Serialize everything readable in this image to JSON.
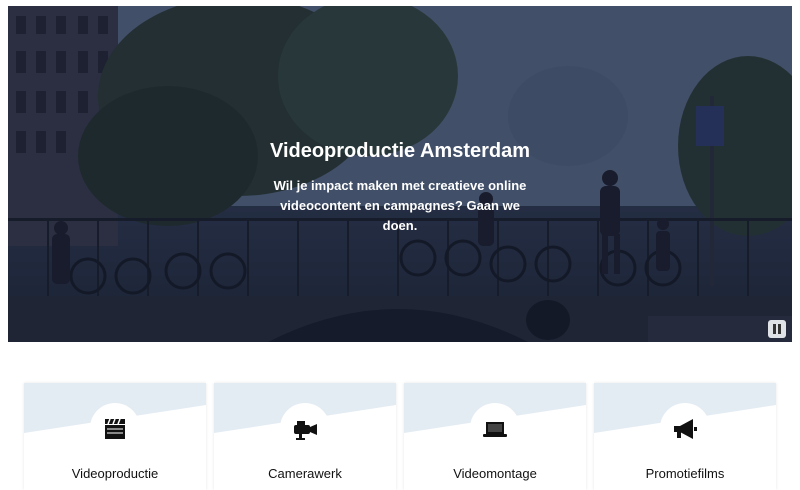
{
  "hero": {
    "title": "Videoproductie Amsterdam",
    "subtitle": "Wil je impact maken met creatieve online videocontent en campagnes? Gaan we doen.",
    "pause_icon": "pause-icon"
  },
  "cards": [
    {
      "label": "Videoproductie",
      "icon": "clapperboard-icon"
    },
    {
      "label": "Camerawerk",
      "icon": "video-camera-icon"
    },
    {
      "label": "Videomontage",
      "icon": "laptop-icon"
    },
    {
      "label": "Promotiefilms",
      "icon": "megaphone-icon"
    }
  ],
  "colors": {
    "card_top": "#e3ebf3",
    "overlay": "#1e2a50"
  }
}
